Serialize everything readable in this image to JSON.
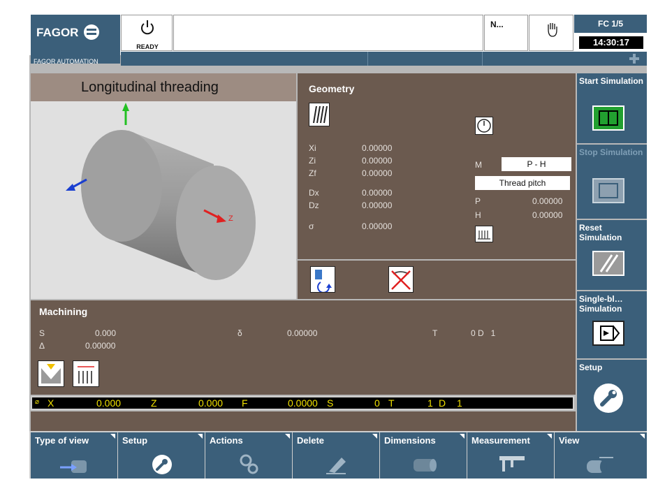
{
  "header": {
    "brand": "FAGOR",
    "brand_sub": "FAGOR AUTOMATION",
    "status": "READY",
    "mode_abbrev": "N...",
    "channel": "FC 1/5",
    "time": "14:30:17"
  },
  "graphic": {
    "title": "Longitudinal threading",
    "axis_z_label": "Z"
  },
  "geometry": {
    "title": "Geometry",
    "fields": [
      {
        "label": "Xi",
        "value": "0.00000"
      },
      {
        "label": "Zi",
        "value": "0.00000"
      },
      {
        "label": "Zf",
        "value": "0.00000"
      },
      {
        "label": "Dx",
        "value": "0.00000"
      },
      {
        "label": "Dz",
        "value": "0.00000"
      },
      {
        "label": "σ",
        "value": "0.00000"
      }
    ],
    "m_label": "M",
    "m_value": "P - H",
    "pitch_mode": "Thread pitch",
    "p_label": "P",
    "p_value": "0.00000",
    "h_label": "H",
    "h_value": "0.00000"
  },
  "machining": {
    "title": "Machining",
    "s_label": "S",
    "s_value": "0.000",
    "delta_label": "δ",
    "delta_value": "0.00000",
    "t_label": "T",
    "t_value": "0 D   1",
    "Delta_label": "Δ",
    "Delta_value": "0.00000"
  },
  "coord_bar": {
    "x_label": "X",
    "x_value": "0.000",
    "z_label": "Z",
    "z_value": "0.000",
    "f_label": "F",
    "f_value": "0.0000",
    "s_label": "S",
    "s_value": "0",
    "t_label": "T",
    "t_value": "1",
    "d_label": "D",
    "d_value": "1"
  },
  "side_menu": [
    {
      "label": "Start Simulation",
      "enabled": true
    },
    {
      "label": "Stop Simulation",
      "enabled": false
    },
    {
      "label": "Reset Simulation",
      "enabled": true
    },
    {
      "label": "Single-bl… Simulation",
      "enabled": true
    },
    {
      "label": "Setup",
      "enabled": true
    }
  ],
  "softkeys": [
    "Type of view",
    "Setup",
    "Actions",
    "Delete",
    "Dimensions",
    "Measurement",
    "View"
  ],
  "colors": {
    "panel_blue": "#3b5f7a",
    "panel_brown": "#6b5a4f",
    "title_tan": "#9d8c82",
    "coord_yellow": "#f0e000"
  }
}
